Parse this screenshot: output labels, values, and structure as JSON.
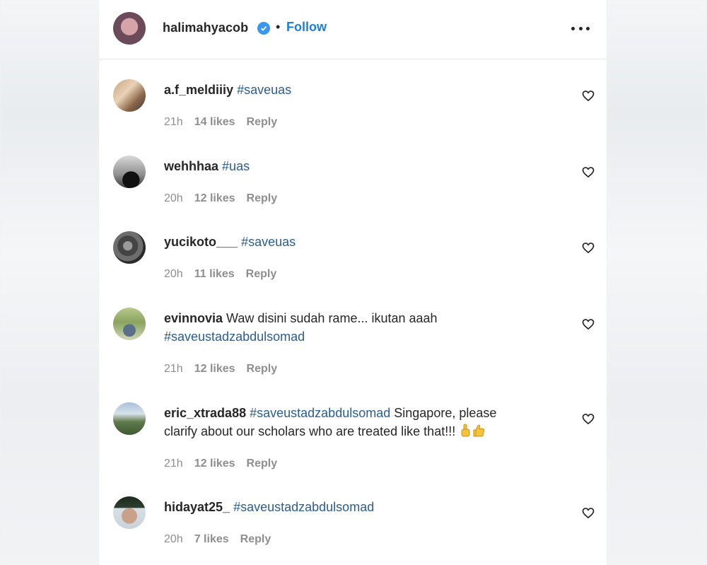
{
  "header": {
    "username": "halimahyacob",
    "verified_icon": "verified-badge-icon",
    "separator": "•",
    "follow_label": "Follow",
    "more_icon": "more-options-icon"
  },
  "colors": {
    "link": "#1f7fd6",
    "hashtag": "#2b5d8f",
    "meta": "#8e8e8e",
    "verified": "#3897f0"
  },
  "comments": [
    {
      "user": "a.f_meldiiiy",
      "text": "#saveuas",
      "line2": "",
      "time": "21h",
      "likes": "14 likes",
      "reply": "Reply"
    },
    {
      "user": "wehhhaa",
      "text": "#uas",
      "line2": "",
      "time": "20h",
      "likes": "12 likes",
      "reply": "Reply"
    },
    {
      "user": "yucikoto___",
      "text": "#saveuas",
      "line2": "",
      "time": "20h",
      "likes": "11 likes",
      "reply": "Reply"
    },
    {
      "user": "evinnovia",
      "text": "Waw disini sudah rame... ikutan aaah",
      "line2": "#saveustadzabdulsomad",
      "time": "21h",
      "likes": "12 likes",
      "reply": "Reply"
    },
    {
      "user": "eric_xtrada88",
      "text_tag": "#saveustadzabdulsomad",
      "text": "Singapore, please",
      "line2": "clarify about our scholars who are treated like that!!!",
      "emoji": "☝👍",
      "time": "21h",
      "likes": "12 likes",
      "reply": "Reply"
    },
    {
      "user": "hidayat25_",
      "text": "#saveustadzabdulsomad",
      "line2": "",
      "time": "20h",
      "likes": "7 likes",
      "reply": "Reply"
    }
  ]
}
